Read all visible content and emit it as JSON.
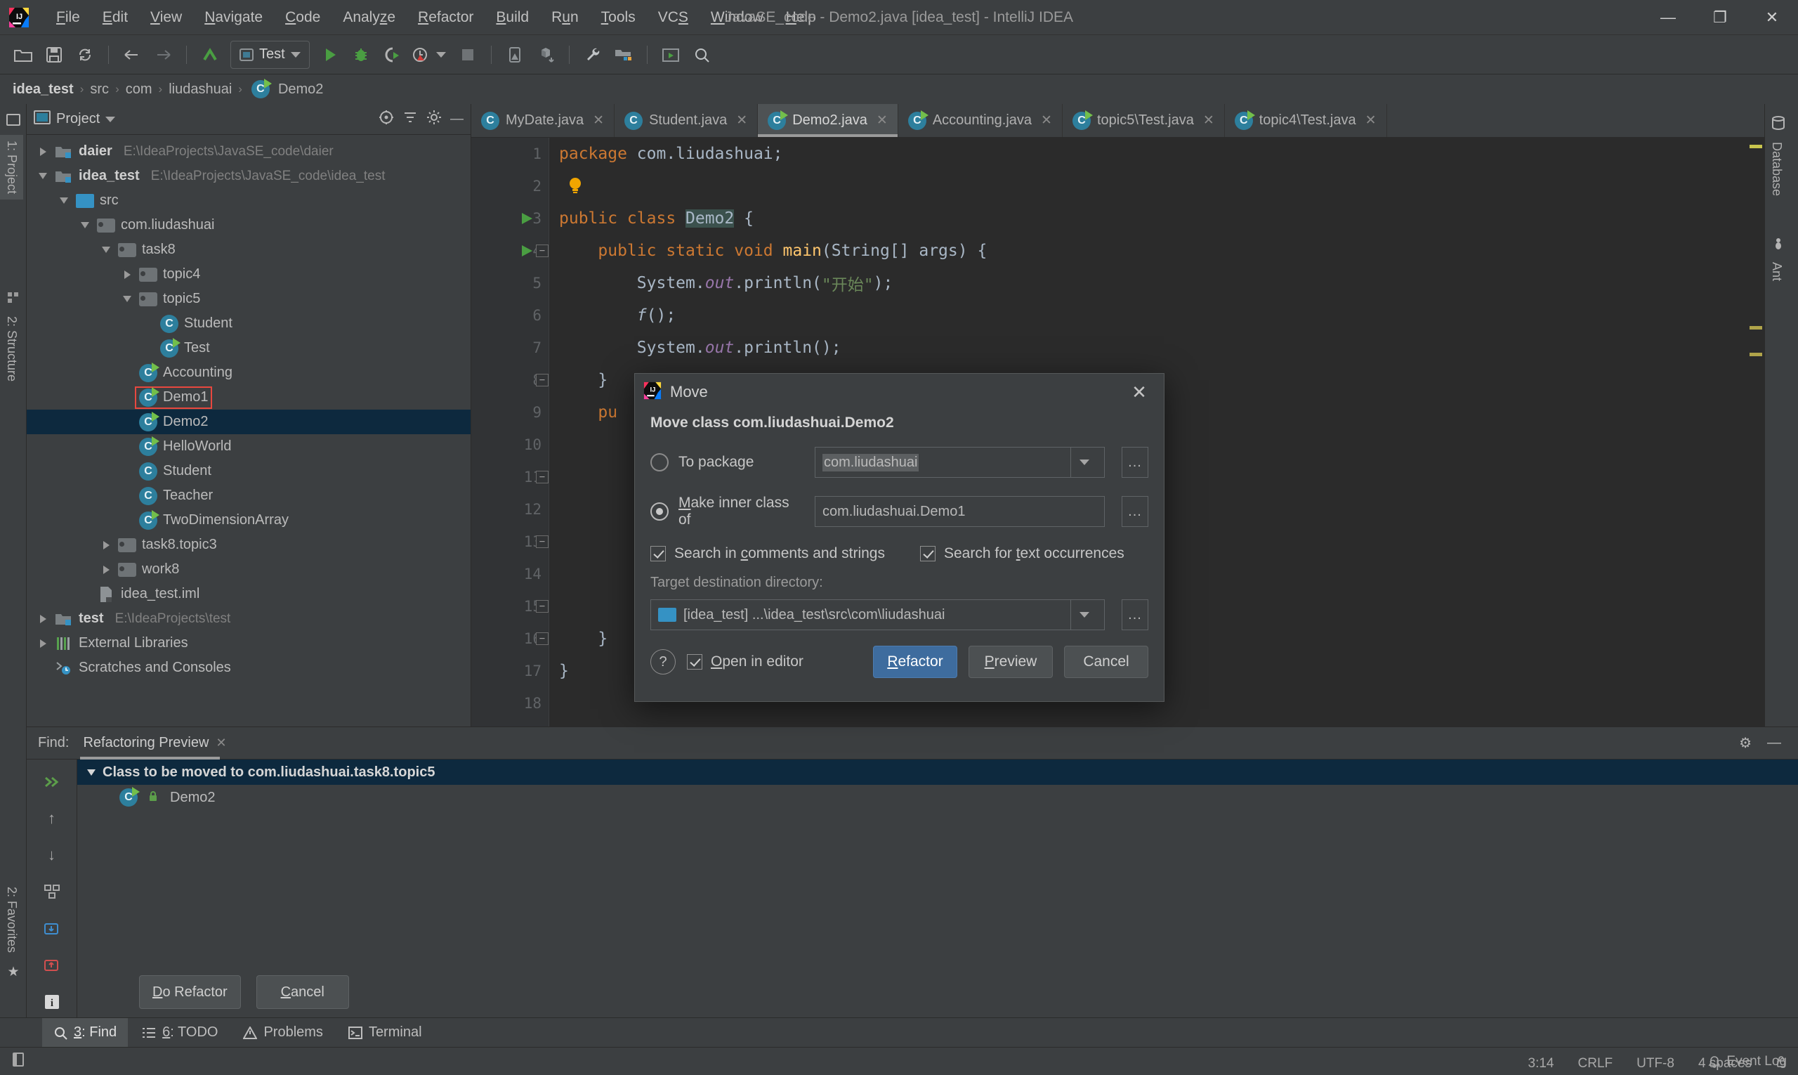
{
  "window": {
    "title": "JavaSE_code - Demo2.java [idea_test] - IntelliJ IDEA",
    "minimize": "—",
    "maximize": "❐",
    "close": "✕"
  },
  "menubar": [
    {
      "label": "File",
      "mnemonic": "F"
    },
    {
      "label": "Edit",
      "mnemonic": "E"
    },
    {
      "label": "View",
      "mnemonic": "V"
    },
    {
      "label": "Navigate",
      "mnemonic": "N"
    },
    {
      "label": "Code",
      "mnemonic": "C"
    },
    {
      "label": "Analyze",
      "mnemonic": "z"
    },
    {
      "label": "Refactor",
      "mnemonic": "R"
    },
    {
      "label": "Build",
      "mnemonic": "B"
    },
    {
      "label": "Run",
      "mnemonic": "u"
    },
    {
      "label": "Tools",
      "mnemonic": "T"
    },
    {
      "label": "VCS",
      "mnemonic": "S"
    },
    {
      "label": "Window",
      "mnemonic": "W"
    },
    {
      "label": "Help",
      "mnemonic": "H"
    }
  ],
  "toolbar": {
    "run_config": "Test",
    "icons": [
      "open-folder-icon",
      "save-all-icon",
      "sync-icon",
      "back-arrow-icon",
      "forward-arrow-icon",
      "undo-icon"
    ],
    "run_icons": [
      "run-icon",
      "debug-icon",
      "run-with-coverage-icon",
      "profiler-icon",
      "stop-icon"
    ],
    "right_icons": [
      "device-manager-icon",
      "sync-gradle-icon",
      "settings-wrench-icon",
      "project-structure-icon",
      "avd-icon",
      "search-everywhere-icon"
    ]
  },
  "breadcrumb": {
    "items": [
      "idea_test",
      "src",
      "com",
      "liudashuai",
      "Demo2"
    ],
    "separator": "›"
  },
  "rails": {
    "left_top": "1: Project",
    "left_mid": "2: Structure",
    "left_bottom": "2: Favorites",
    "right": [
      "Database",
      "Ant"
    ]
  },
  "project_panel": {
    "title": "Project",
    "tree": [
      {
        "depth": 0,
        "caret": "right",
        "icon": "module-icon",
        "label": "daier",
        "bold": true,
        "path": "E:\\IdeaProjects\\JavaSE_code\\daier"
      },
      {
        "depth": 0,
        "caret": "down",
        "icon": "module-icon",
        "label": "idea_test",
        "bold": true,
        "path": "E:\\IdeaProjects\\JavaSE_code\\idea_test"
      },
      {
        "depth": 1,
        "caret": "down",
        "icon": "source-folder-icon",
        "label": "src",
        "bold": false,
        "path": ""
      },
      {
        "depth": 2,
        "caret": "down",
        "icon": "package-icon",
        "label": "com.liudashuai",
        "bold": false,
        "path": ""
      },
      {
        "depth": 3,
        "caret": "down",
        "icon": "package-icon",
        "label": "task8",
        "bold": false,
        "path": ""
      },
      {
        "depth": 4,
        "caret": "right",
        "icon": "package-icon",
        "label": "topic4",
        "bold": false,
        "path": ""
      },
      {
        "depth": 4,
        "caret": "down",
        "icon": "package-icon",
        "label": "topic5",
        "bold": false,
        "path": ""
      },
      {
        "depth": 5,
        "caret": "none",
        "icon": "class-icon",
        "label": "Student",
        "bold": false,
        "path": ""
      },
      {
        "depth": 5,
        "caret": "none",
        "icon": "runnable-class-icon",
        "label": "Test",
        "bold": false,
        "path": ""
      },
      {
        "depth": 4,
        "caret": "none",
        "icon": "runnable-class-icon",
        "label": "Accounting",
        "bold": false,
        "path": ""
      },
      {
        "depth": 4,
        "caret": "none",
        "icon": "runnable-class-icon",
        "label": "Demo1",
        "bold": false,
        "path": "",
        "highlight": true
      },
      {
        "depth": 4,
        "caret": "none",
        "icon": "runnable-class-icon",
        "label": "Demo2",
        "bold": false,
        "path": "",
        "selected": true
      },
      {
        "depth": 4,
        "caret": "none",
        "icon": "runnable-class-icon",
        "label": "HelloWorld",
        "bold": false,
        "path": ""
      },
      {
        "depth": 4,
        "caret": "none",
        "icon": "class-icon",
        "label": "Student",
        "bold": false,
        "path": ""
      },
      {
        "depth": 4,
        "caret": "none",
        "icon": "class-icon",
        "label": "Teacher",
        "bold": false,
        "path": ""
      },
      {
        "depth": 4,
        "caret": "none",
        "icon": "runnable-class-icon",
        "label": "TwoDimensionArray",
        "bold": false,
        "path": ""
      },
      {
        "depth": 3,
        "caret": "right",
        "icon": "package-icon",
        "label": "task8.topic3",
        "bold": false,
        "path": ""
      },
      {
        "depth": 3,
        "caret": "right",
        "icon": "package-icon",
        "label": "work8",
        "bold": false,
        "path": ""
      },
      {
        "depth": 2,
        "caret": "none",
        "icon": "iml-file-icon",
        "label": "idea_test.iml",
        "bold": false,
        "path": ""
      },
      {
        "depth": 0,
        "caret": "right",
        "icon": "module-icon",
        "label": "test",
        "bold": true,
        "path": "E:\\IdeaProjects\\test"
      },
      {
        "depth": 0,
        "caret": "right",
        "icon": "libraries-icon",
        "label": "External Libraries",
        "bold": false,
        "path": ""
      },
      {
        "depth": 0,
        "caret": "none",
        "icon": "scratches-icon",
        "label": "Scratches and Consoles",
        "bold": false,
        "path": ""
      }
    ]
  },
  "editor": {
    "tabs": [
      {
        "label": "MyDate.java",
        "icon": "class-icon",
        "active": false
      },
      {
        "label": "Student.java",
        "icon": "class-icon",
        "active": false
      },
      {
        "label": "Demo2.java",
        "icon": "runnable-class-icon",
        "active": true
      },
      {
        "label": "Accounting.java",
        "icon": "runnable-class-icon",
        "active": false
      },
      {
        "label": "topic5\\Test.java",
        "icon": "runnable-class-icon",
        "active": false
      },
      {
        "label": "topic4\\Test.java",
        "icon": "runnable-class-icon",
        "active": false
      }
    ],
    "close_glyph": "✕",
    "line_numbers": [
      "1",
      "2",
      "3",
      "4",
      "5",
      "6",
      "7",
      "8",
      "9",
      "10",
      "11",
      "12",
      "13",
      "14",
      "15",
      "16",
      "17",
      "18"
    ],
    "code_lines": [
      {
        "n": 1,
        "tokens": [
          {
            "t": "package ",
            "c": "kw"
          },
          {
            "t": "com.liudashuai;",
            "c": "id"
          }
        ]
      },
      {
        "n": 2,
        "tokens": [],
        "bulb": true
      },
      {
        "n": 3,
        "tokens": [
          {
            "t": "public class ",
            "c": "kw"
          },
          {
            "t": "Demo2",
            "c": "hl-id"
          },
          {
            "t": " {",
            "c": "id"
          }
        ],
        "run": true
      },
      {
        "n": 4,
        "tokens": [
          {
            "t": "    public static void ",
            "c": "kw"
          },
          {
            "t": "main",
            "c": "fn"
          },
          {
            "t": "(String[] args) {",
            "c": "id"
          }
        ],
        "run": true,
        "fold": true
      },
      {
        "n": 5,
        "tokens": [
          {
            "t": "        System.",
            "c": "id"
          },
          {
            "t": "out",
            "c": "fld"
          },
          {
            "t": ".println(",
            "c": "id"
          },
          {
            "t": "\"开始\"",
            "c": "st"
          },
          {
            "t": ");",
            "c": "id"
          }
        ]
      },
      {
        "n": 6,
        "tokens": [
          {
            "t": "        ",
            "c": "id"
          },
          {
            "t": "f",
            "c": "mi"
          },
          {
            "t": "();",
            "c": "id"
          }
        ]
      },
      {
        "n": 7,
        "tokens": [
          {
            "t": "        System.",
            "c": "id"
          },
          {
            "t": "out",
            "c": "fld"
          },
          {
            "t": ".println();",
            "c": "id"
          }
        ]
      },
      {
        "n": 8,
        "tokens": [
          {
            "t": "    }",
            "c": "id"
          }
        ],
        "fold2": true
      },
      {
        "n": 9,
        "tokens": [
          {
            "t": "    pu",
            "c": "kw"
          }
        ]
      },
      {
        "n": 10,
        "tokens": []
      },
      {
        "n": 11,
        "tokens": [],
        "fold2": true
      },
      {
        "n": 12,
        "tokens": []
      },
      {
        "n": 13,
        "tokens": [],
        "fold2": true
      },
      {
        "n": 14,
        "tokens": []
      },
      {
        "n": 15,
        "tokens": [],
        "fold2": true
      },
      {
        "n": 16,
        "tokens": [
          {
            "t": "    }",
            "c": "id"
          }
        ],
        "fold2": true
      },
      {
        "n": 17,
        "tokens": [
          {
            "t": "}",
            "c": "id"
          }
        ]
      },
      {
        "n": 18,
        "tokens": []
      }
    ]
  },
  "dialog": {
    "title": "Move",
    "close_glyph": "✕",
    "heading": "Move class com.liudashuai.Demo2",
    "to_package": {
      "label": "To package",
      "value": "com.liudashuai",
      "selected": false,
      "browse": "..."
    },
    "make_inner": {
      "label_pre": "",
      "label": "Make inner class of",
      "mnemonic": "M",
      "value": "com.liudashuai.Demo1",
      "selected": true,
      "browse": "..."
    },
    "search_comments": {
      "label": "Search in comments and strings",
      "mnemonic": "c",
      "checked": true
    },
    "search_text": {
      "label": "Search for text occurrences",
      "mnemonic": "t",
      "checked": true
    },
    "target_label": "Target destination directory:",
    "target_value": "[idea_test] ...\\idea_test\\src\\com\\liudashuai",
    "target_browse": "...",
    "help_glyph": "?",
    "open_in_editor": {
      "label": "Open in editor",
      "mnemonic": "O",
      "checked": true
    },
    "buttons": {
      "refactor": "Refactor",
      "preview": "Preview",
      "cancel": "Cancel"
    }
  },
  "find_panel": {
    "find_label": "Find:",
    "tab_label": "Refactoring Preview",
    "tab_close": "✕",
    "results": [
      {
        "type": "group",
        "label": "Class to be moved to com.liudashuai.task8.topic5",
        "selected": true,
        "caret": "down"
      },
      {
        "type": "item",
        "label": "Demo2",
        "icon": "runnable-class-icon",
        "locked": true
      }
    ],
    "rail_icons": [
      "expand-all-icon",
      "previous-occurrence-icon",
      "next-occurrence-icon",
      "group-by-icon",
      "export-icon",
      "import-icon",
      "info-icon"
    ],
    "actions": {
      "do_refactor": "Do Refactor",
      "cancel": "Cancel"
    },
    "settings_glyph": "⚙",
    "hide_glyph": "—"
  },
  "tool_window_bar": [
    {
      "label": "3: Find",
      "mnemonic": "3",
      "icon": "search-icon",
      "active": true
    },
    {
      "label": "6: TODO",
      "mnemonic": "6",
      "icon": "todo-list-icon",
      "active": false
    },
    {
      "label": "Problems",
      "icon": "warning-triangle-icon",
      "active": false
    },
    {
      "label": "Terminal",
      "icon": "terminal-icon",
      "active": false
    }
  ],
  "statusbar": {
    "caret": "3:14",
    "line_sep": "CRLF",
    "encoding": "UTF-8",
    "indent": "4 spaces",
    "event_log": "Event Log",
    "event_log_icon": "bell-icon",
    "lock_icon": "lock-icon"
  },
  "colors": {
    "bg": "#3c3f41",
    "editor_bg": "#2b2b2b",
    "selection": "#0d293e",
    "accent_blue": "#3e6c9e",
    "highlight_red": "#e8483f",
    "icon_blue": "#2d7f9d",
    "run_green": "#73bf4b",
    "keyword_orange": "#cc7832",
    "string_green": "#6a8759",
    "method_yellow": "#ffc66d",
    "field_purple": "#9876aa"
  }
}
